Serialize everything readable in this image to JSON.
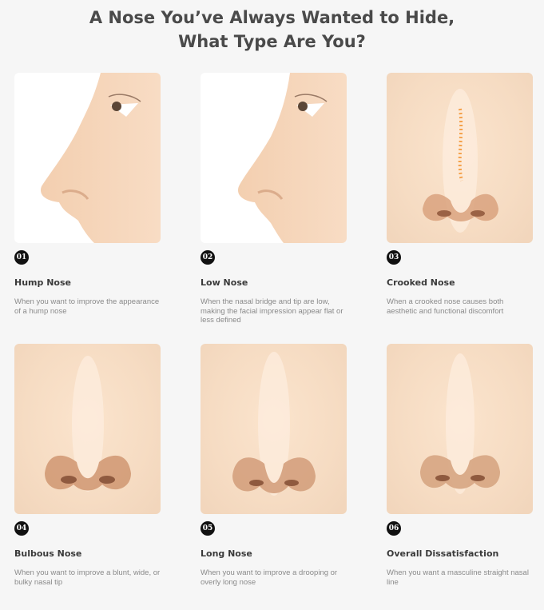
{
  "title": {
    "line1": "A Nose You’ve Always Wanted to Hide,",
    "line2": "What Type Are You?"
  },
  "cards": [
    {
      "number": "01",
      "name": "Hump Nose",
      "description": "When you want to improve the appearance of a hump nose",
      "illustration": "profile-hump-nose"
    },
    {
      "number": "02",
      "name": "Low Nose",
      "description": "When the nasal bridge and tip are low, making the facial impression appear flat or less defined",
      "illustration": "profile-low-nose"
    },
    {
      "number": "03",
      "name": "Crooked Nose",
      "description": "When a crooked nose causes both aesthetic and functional discomfort",
      "illustration": "front-crooked-nose"
    },
    {
      "number": "04",
      "name": "Bulbous Nose",
      "description": "When you want to improve a blunt, wide, or bulky nasal tip",
      "illustration": "front-bulbous-nose"
    },
    {
      "number": "05",
      "name": "Long Nose",
      "description": "When you want to improve a drooping or overly long nose",
      "illustration": "front-long-nose"
    },
    {
      "number": "06",
      "name": "Overall Dissatisfaction",
      "description": "When you want a masculine straight nasal line",
      "illustration": "front-straight-nose"
    }
  ],
  "colors": {
    "background": "#f6f6f6",
    "skin": "#f6dcc3",
    "badge": "#111111"
  }
}
